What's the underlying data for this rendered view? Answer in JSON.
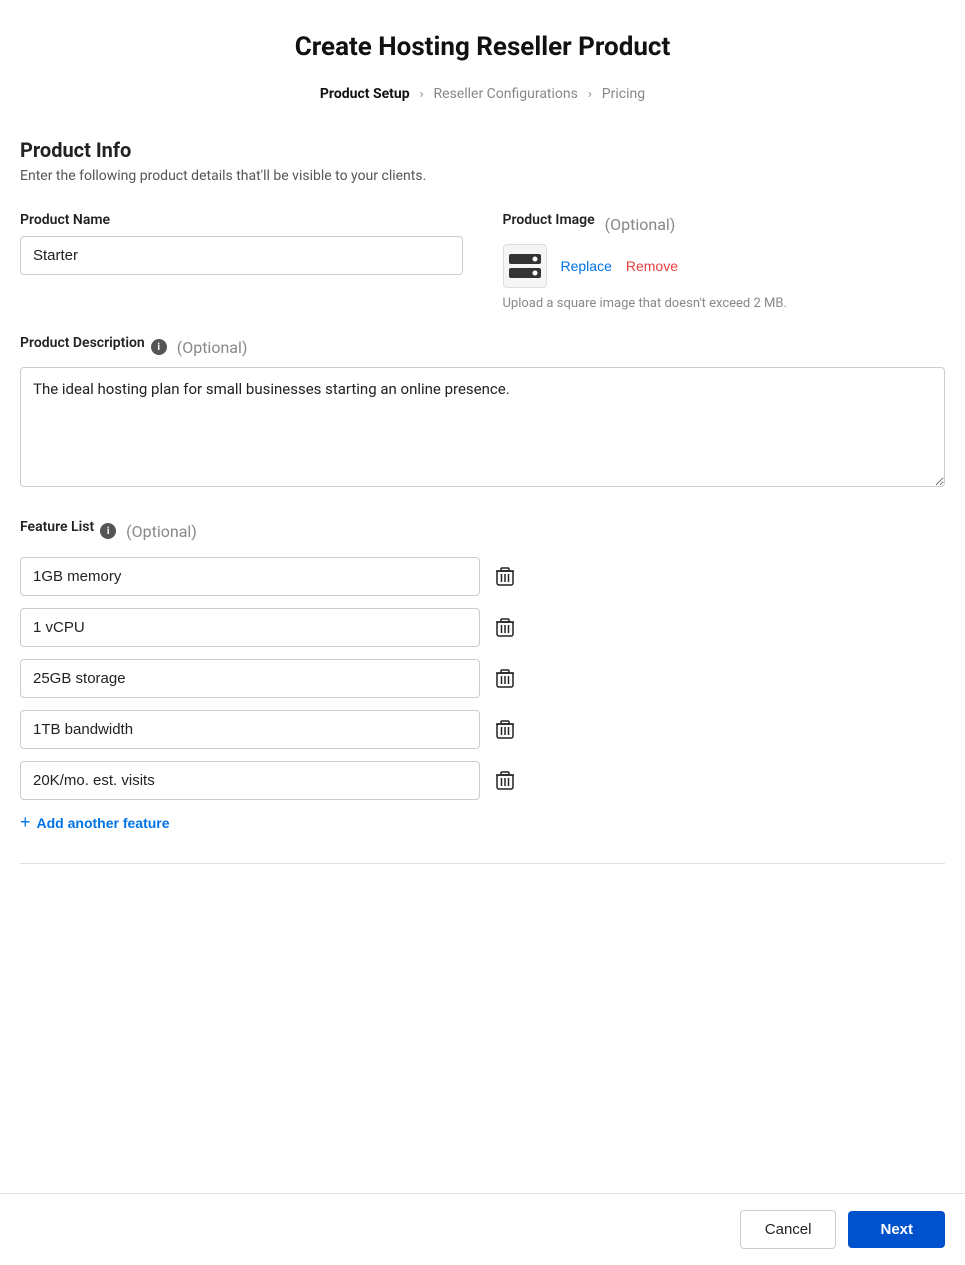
{
  "page": {
    "title": "Create Hosting Reseller Product"
  },
  "breadcrumb": {
    "steps": [
      {
        "label": "Product Setup",
        "active": true
      },
      {
        "label": "Reseller Configurations",
        "active": false
      },
      {
        "label": "Pricing",
        "active": false
      }
    ]
  },
  "section": {
    "title": "Product Info",
    "subtitle": "Enter the following product details that'll be visible to your clients."
  },
  "product_name": {
    "label": "Product Name",
    "value": "Starter"
  },
  "product_image": {
    "label": "Product Image",
    "optional": "(Optional)",
    "replace_label": "Replace",
    "remove_label": "Remove",
    "hint": "Upload a square image that doesn't exceed 2 MB."
  },
  "product_description": {
    "label": "Product Description",
    "optional": "(Optional)",
    "value": "The ideal hosting plan for small businesses starting an online presence."
  },
  "feature_list": {
    "label": "Feature List",
    "optional": "(Optional)",
    "features": [
      {
        "value": "1GB memory"
      },
      {
        "value": "1 vCPU"
      },
      {
        "value": "25GB storage"
      },
      {
        "value": "1TB bandwidth"
      },
      {
        "value": "20K/mo. est. visits"
      }
    ],
    "add_label": "Add another feature"
  },
  "footer": {
    "cancel_label": "Cancel",
    "next_label": "Next"
  }
}
